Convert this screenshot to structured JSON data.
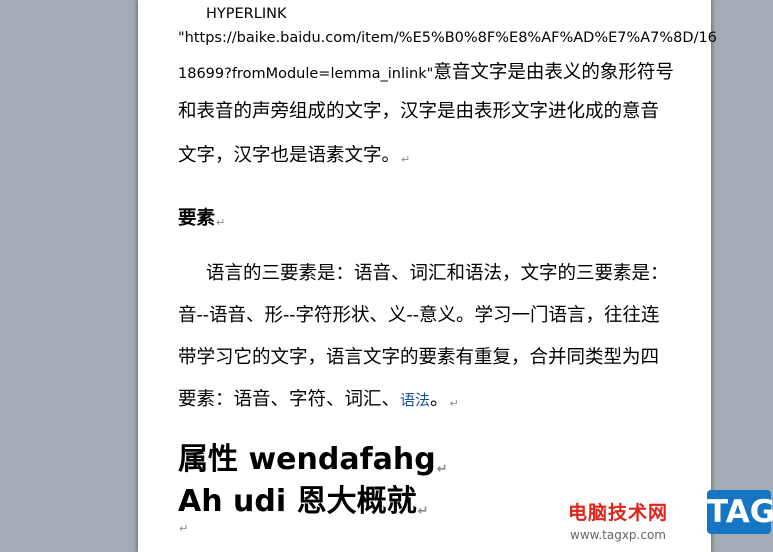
{
  "document": {
    "hyperlink_field_code": "HYPERLINK",
    "hyperlink_url_part1": "\"https://baike.baidu.com/item/%E5%B0%8F%E8%AF%AD%E7%A7%8D/16",
    "hyperlink_url_part2": "18699?fromModule=lemma_inlink\"",
    "para1_line1_tail": "意音文字是由表义的象形符号",
    "para1_line2": "和表音的声旁组成的文字，汉字是由表形文字进化成的意音",
    "para1_line3": "文字，汉字也是语素文字。",
    "heading_elements": "要素",
    "para2_line1": "语言的三要素是：语音、词汇和语法，文字的三要素是：",
    "para2_line2": "音--语音、形--字符形状、义--意义。学习一门语言，往往连",
    "para2_line3": "带学习它的文字，语言文字的要素有重复，合并同类型为四",
    "para2_line4_text": "要素：语音、字符、词汇、",
    "para2_line4_link": "语法",
    "para2_line4_end": "。",
    "big_line1": "属性 wendafahg",
    "big_line2": "Ah udi 恩大概就",
    "paragraph_mark": "↵"
  },
  "watermark": {
    "site_name": "电脑技术网",
    "url": "www.tagxp.com",
    "tag": "TAG"
  }
}
